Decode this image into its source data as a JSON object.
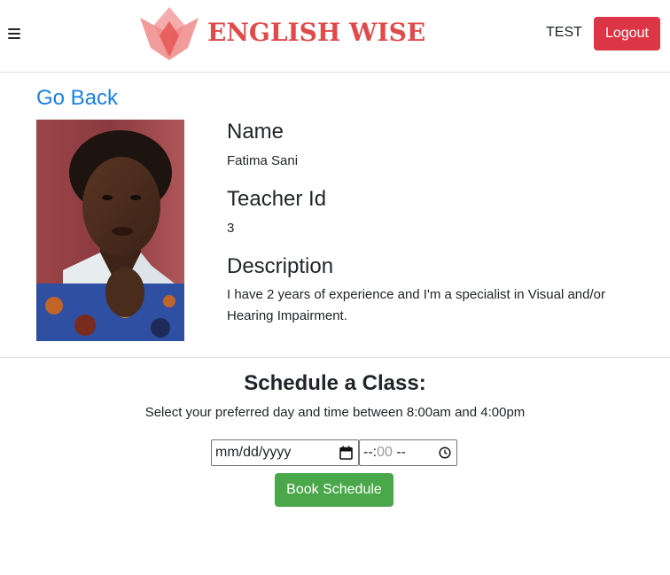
{
  "header": {
    "brand": "ENGLISH WISE",
    "menu_icon": "hamburger-menu-icon",
    "username": "TEST",
    "logout_label": "Logout",
    "brand_color": "#e04a4a"
  },
  "nav": {
    "go_back_label": "Go Back"
  },
  "teacher": {
    "name_heading": "Name",
    "name": "Fatima Sani",
    "id_heading": "Teacher Id",
    "id": "3",
    "description_heading": "Description",
    "description": "I have 2 years of experience and I'm a specialist in Visual and/or Hearing Impairment."
  },
  "schedule": {
    "title": "Schedule a Class:",
    "subtitle": "Select your preferred day and time between 8:00am and 4:00pm",
    "date_placeholder": "mm/dd/yyyy",
    "time_placeholder_a": "--:",
    "time_placeholder_b": "00",
    "time_placeholder_c": " --",
    "book_label": "Book Schedule"
  },
  "colors": {
    "link": "#1a7fe0",
    "danger": "#dc3545",
    "success": "#4aa84a"
  }
}
